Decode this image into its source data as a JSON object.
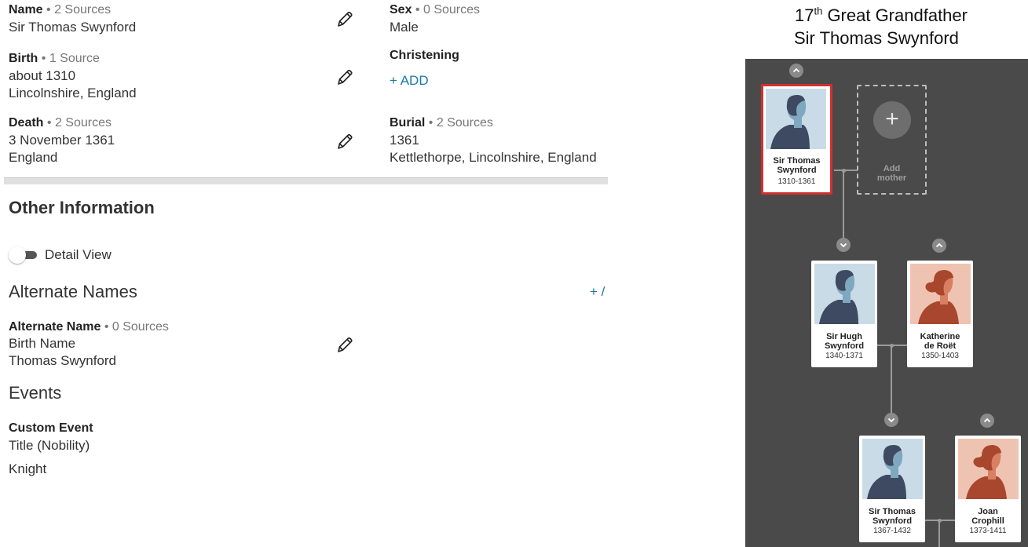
{
  "vitals": {
    "name": {
      "label": "Name",
      "sources": "• 2 Sources",
      "value": "Sir Thomas Swynford"
    },
    "sex": {
      "label": "Sex",
      "sources": "• 0 Sources",
      "value": "Male"
    },
    "birth": {
      "label": "Birth",
      "sources": "• 1 Source",
      "date": "about 1310",
      "place": "Lincolnshire, England"
    },
    "christening": {
      "label": "Christening",
      "add": "+  ADD"
    },
    "death": {
      "label": "Death",
      "sources": "• 2 Sources",
      "date": "3 November 1361",
      "place": "England"
    },
    "burial": {
      "label": "Burial",
      "sources": "• 2 Sources",
      "date": "1361",
      "place": "Kettlethorpe, Lincolnshire, England"
    }
  },
  "other_info": {
    "heading": "Other Information",
    "detail_view_label": "Detail View",
    "alternate_names_heading": "Alternate Names",
    "alternate_names_add": "+ /",
    "alt_name": {
      "label": "Alternate Name",
      "sources": "• 0 Sources",
      "type": "Birth Name",
      "value": "Thomas Swynford"
    },
    "events_heading": "Events",
    "custom_event": {
      "label": "Custom Event",
      "type": "Title (Nobility)",
      "value": "Knight"
    }
  },
  "caption": {
    "ordinal": "17",
    "ordinal_suffix": "th",
    "relation": " Great Grandfather",
    "name": "Sir Thomas Swynford"
  },
  "tree": {
    "selected": {
      "name_line1": "Sir Thomas",
      "name_line2": "Swynford",
      "dates": "1310-1361"
    },
    "add_mother": {
      "line1": "Add",
      "line2": "mother",
      "plus": "+"
    },
    "son": {
      "name_line1": "Sir Hugh",
      "name_line2": "Swynford",
      "dates": "1340-1371"
    },
    "son_wife": {
      "name_line1": "Katherine",
      "name_line2": "de Roët",
      "dates": "1350-1403"
    },
    "grandson": {
      "name_line1": "Sir Thomas",
      "name_line2": "Swynford",
      "dates": "1367-1432"
    },
    "grandson_wife": {
      "name_line1": "Joan",
      "name_line2": "Crophill",
      "dates": "1373-1411"
    }
  },
  "colors": {
    "accent_link": "#1a7aa5",
    "tree_bg": "#4a4a4a",
    "selected_border": "#d32f2f",
    "male_bg": "#c9dbe6",
    "female_bg": "#efc3b1"
  }
}
